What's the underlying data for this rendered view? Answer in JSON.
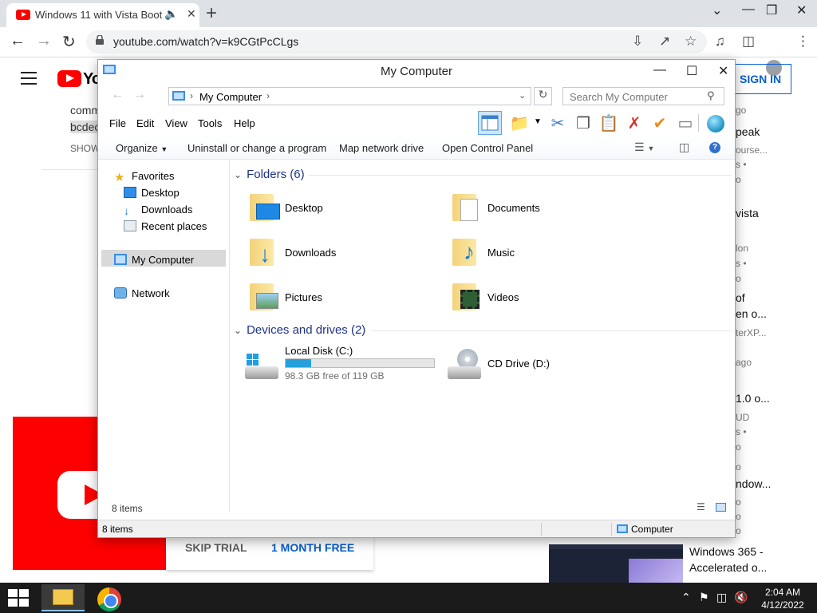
{
  "browser": {
    "tab_title": "Windows 11 with Vista Boot",
    "url": "youtube.com/watch?v=k9CGtPcCLgs"
  },
  "youtube": {
    "logo_text": "You",
    "sign_in": "SIGN IN",
    "comment_fragments": [
      "comm",
      "bcdec",
      "SHOW"
    ],
    "skip_trial": "SKIP TRIAL",
    "month_free": "1 MONTH FREE",
    "sidebar_fragments": [
      {
        "text": "go",
        "kind": "meta"
      },
      {
        "text": "peak",
        "kind": "title"
      },
      {
        "text": "ourse...",
        "kind": "meta"
      },
      {
        "text": "s •",
        "kind": "meta"
      },
      {
        "text": "o",
        "kind": "meta"
      },
      {
        "text": "vista",
        "kind": "title"
      },
      {
        "text": "lon",
        "kind": "meta"
      },
      {
        "text": "s •",
        "kind": "meta"
      },
      {
        "text": "o",
        "kind": "meta"
      },
      {
        "text": "of",
        "kind": "title"
      },
      {
        "text": "en o...",
        "kind": "title"
      },
      {
        "text": "terXP...",
        "kind": "meta"
      },
      {
        "text": "ago",
        "kind": "meta"
      },
      {
        "text": "1.0 o...",
        "kind": "title"
      },
      {
        "text": "UD",
        "kind": "meta"
      },
      {
        "text": "s •",
        "kind": "meta"
      },
      {
        "text": "o",
        "kind": "meta"
      },
      {
        "text": "o",
        "kind": "meta"
      },
      {
        "text": "ndow...",
        "kind": "title"
      },
      {
        "text": "o",
        "kind": "meta"
      },
      {
        "text": "o",
        "kind": "meta"
      },
      {
        "text": "o",
        "kind": "meta"
      }
    ],
    "related": {
      "title_line1": "Windows 365 -",
      "title_line2": "Accelerated o..."
    }
  },
  "explorer": {
    "title": "My Computer",
    "breadcrumb": "My Computer",
    "search_placeholder": "Search My Computer",
    "menu": [
      "File",
      "Edit",
      "View",
      "Tools",
      "Help"
    ],
    "commands": {
      "organize": "Organize",
      "uninstall": "Uninstall or change a program",
      "map_drive": "Map network drive",
      "control_panel": "Open Control Panel"
    },
    "nav": {
      "favorites": "Favorites",
      "desktop": "Desktop",
      "downloads": "Downloads",
      "recent": "Recent places",
      "computer": "My Computer",
      "network": "Network"
    },
    "folders_header": "Folders (6)",
    "folders": [
      "Desktop",
      "Documents",
      "Downloads",
      "Music",
      "Pictures",
      "Videos"
    ],
    "devices_header": "Devices and drives (2)",
    "drives": {
      "local_name": "Local Disk (C:)",
      "local_free": "98.3 GB free of 119 GB",
      "local_used_fraction": 0.174,
      "cd_name": "CD Drive (D:)"
    },
    "item_count": "8 items",
    "status_left": "8 items",
    "status_right": "Computer"
  },
  "taskbar": {
    "time": "2:04 AM",
    "date": "4/12/2022"
  },
  "colors": {
    "accent_blue": "#26a0da",
    "youtube_red": "#ff0000",
    "link_blue": "#065fd4",
    "taskbar": "#1b1b1b"
  }
}
